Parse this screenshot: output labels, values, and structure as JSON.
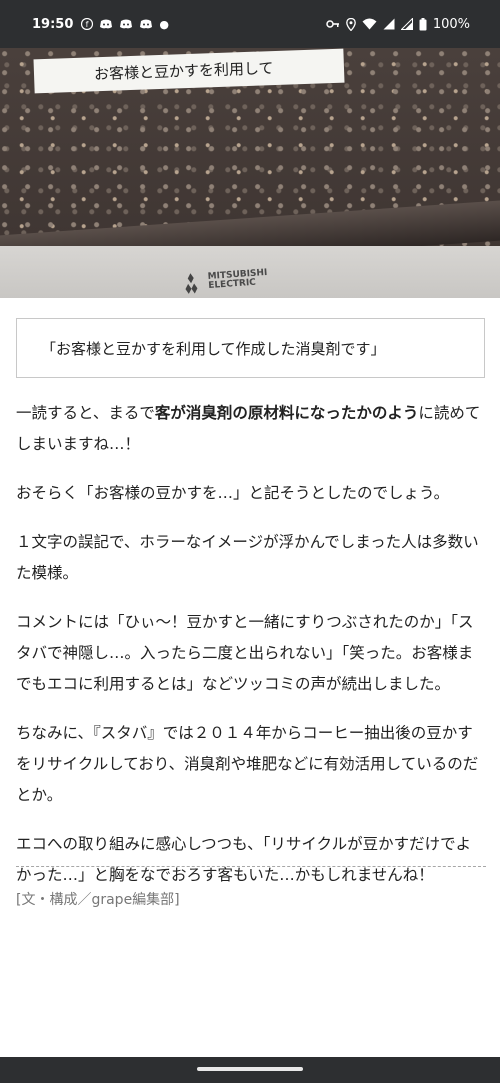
{
  "status_bar": {
    "time": "19:50",
    "battery": "100%",
    "left_icons": [
      "facebook-icon",
      "discord-icon",
      "discord-icon",
      "discord-icon"
    ],
    "right_icons": [
      "vpn-key-icon",
      "location-icon",
      "wifi-icon",
      "signal-icon",
      "signal-icon",
      "battery-icon"
    ]
  },
  "hero": {
    "label_text": "お客様と豆かすを利用して",
    "brand_line1": "MITSUBISHI",
    "brand_line2": "ELECTRIC"
  },
  "article": {
    "quote": "「お客様と豆かすを利用して作成した消臭剤です」",
    "p1_pre": "一読すると、まるで",
    "p1_bold": "客が消臭剤の原材料になったかのよう",
    "p1_post": "に読めてしまいますね…！",
    "p2": "おそらく「お客様の豆かすを…」と記そうとしたのでしょう。",
    "p3": "１文字の誤記で、ホラーなイメージが浮かんでしまった人は多数いた模様。",
    "p4": "コメントには「ひぃ〜！豆かすと一緒にすりつぶされたのか」「スタバで神隠し…。入ったら二度と出られない」「笑った。お客様までもエコに利用するとは」などツッコミの声が続出しました。",
    "p5": "ちなみに、『スタバ』では２０１４年からコーヒー抽出後の豆かすをリサイクルしており、消臭剤や堆肥などに有効活用しているのだとか。",
    "p6": "エコへの取り組みに感心しつつも、「リサイクルが豆かすだけでよかった…」と胸をなでおろす客もいた…かもしれませんね！",
    "credit": "[文・構成／grape編集部]"
  },
  "colors": {
    "system_bar": "#2d2f31",
    "text": "#222222",
    "muted": "#777777",
    "border": "#c8c8c8"
  }
}
